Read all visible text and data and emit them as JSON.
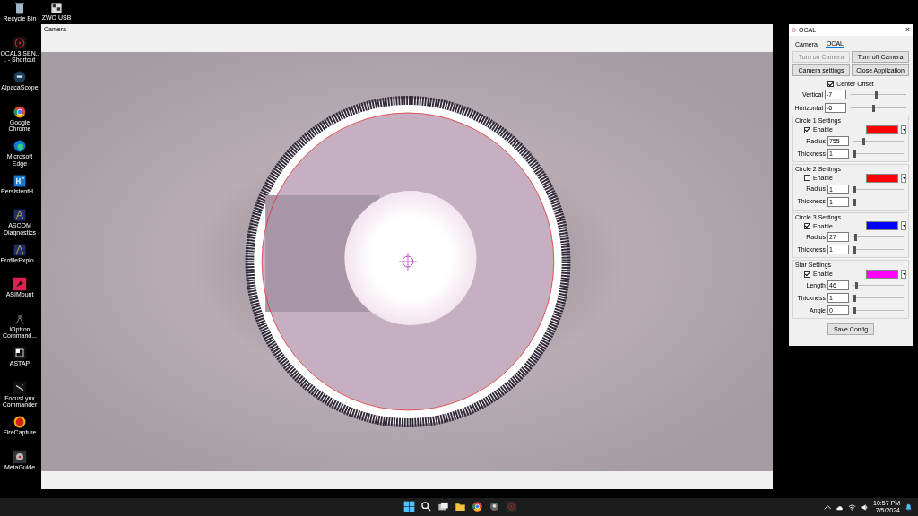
{
  "desktop_icons": [
    {
      "label": "Recycle Bin"
    },
    {
      "label": "OCAL3.SEN... - Shortcut"
    },
    {
      "label": "AlpacaScope"
    },
    {
      "label": "Google Chrome"
    },
    {
      "label": "Microsoft Edge"
    },
    {
      "label": "PersistentH..."
    },
    {
      "label": "ASCOM Diagnostics"
    },
    {
      "label": "ProfileExplo..."
    },
    {
      "label": "ASIMount"
    },
    {
      "label": "iOptron Command..."
    },
    {
      "label": "ASTAP"
    },
    {
      "label": "FocusLynx Commander"
    },
    {
      "label": "FireCapture"
    },
    {
      "label": "MetaGuide"
    }
  ],
  "desktop_icon_partial": {
    "label": "ZWO USB"
  },
  "camera_window": {
    "title": "Camera"
  },
  "ocal_window": {
    "title": "OCAL",
    "close": "×",
    "tabs": [
      {
        "label": "Camera",
        "selected": false
      },
      {
        "label": "OCAL",
        "selected": true
      }
    ],
    "buttons": [
      {
        "label": "Turn on Camera",
        "disabled": true
      },
      {
        "label": "Turn off Camera",
        "disabled": false
      },
      {
        "label": "Camera settings",
        "disabled": false
      },
      {
        "label": "Close Application",
        "disabled": false
      }
    ],
    "center_offset": {
      "label": "Center Offset",
      "checked": true
    },
    "offsets": [
      {
        "label": "Vertical",
        "value": "-7",
        "level": 0.45
      },
      {
        "label": "Horizontal",
        "value": "-6",
        "level": 0.4
      }
    ],
    "groups": [
      {
        "title": "Circle 1 Settings",
        "enable_label": "Enable",
        "checked": true,
        "color": "#ff0000",
        "fields": [
          {
            "label": "Radius",
            "value": "755",
            "level": 0.2
          },
          {
            "label": "Thickness",
            "value": "1",
            "level": 0.02
          }
        ]
      },
      {
        "title": "Circle 2 Settings",
        "enable_label": "Enable",
        "checked": false,
        "color": "#ff0000",
        "fields": [
          {
            "label": "Radius",
            "value": "1",
            "level": 0.02
          },
          {
            "label": "Thickness",
            "value": "1",
            "level": 0.02
          }
        ]
      },
      {
        "title": "Circle 3 Settings",
        "enable_label": "Enable",
        "checked": true,
        "color": "#0000ff",
        "fields": [
          {
            "label": "Radius",
            "value": "27",
            "level": 0.04
          },
          {
            "label": "Thickness",
            "value": "1",
            "level": 0.02
          }
        ]
      },
      {
        "title": "Star Settings",
        "enable_label": "Enable",
        "checked": true,
        "color": "#ff00ff",
        "fields": [
          {
            "label": "Length",
            "value": "46",
            "level": 0.05
          },
          {
            "label": "Thickness",
            "value": "1",
            "level": 0.02
          },
          {
            "label": "Angle",
            "value": "0",
            "level": 0.02
          }
        ]
      }
    ],
    "save_button": "Save Config"
  },
  "taskbar": {
    "time": "10:57 PM",
    "date": "7/5/2024"
  }
}
